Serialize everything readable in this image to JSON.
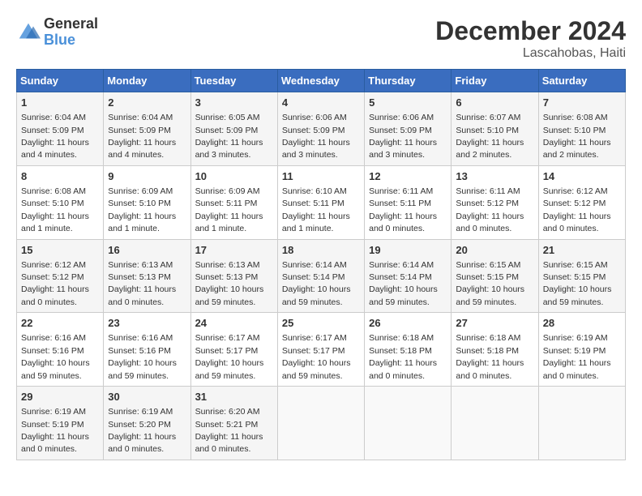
{
  "header": {
    "logo_general": "General",
    "logo_blue": "Blue",
    "title": "December 2024",
    "subtitle": "Lascahobas, Haiti"
  },
  "weekdays": [
    "Sunday",
    "Monday",
    "Tuesday",
    "Wednesday",
    "Thursday",
    "Friday",
    "Saturday"
  ],
  "weeks": [
    [
      {
        "day": "1",
        "sunrise": "6:04 AM",
        "sunset": "5:09 PM",
        "daylight": "11 hours and 4 minutes."
      },
      {
        "day": "2",
        "sunrise": "6:04 AM",
        "sunset": "5:09 PM",
        "daylight": "11 hours and 4 minutes."
      },
      {
        "day": "3",
        "sunrise": "6:05 AM",
        "sunset": "5:09 PM",
        "daylight": "11 hours and 3 minutes."
      },
      {
        "day": "4",
        "sunrise": "6:06 AM",
        "sunset": "5:09 PM",
        "daylight": "11 hours and 3 minutes."
      },
      {
        "day": "5",
        "sunrise": "6:06 AM",
        "sunset": "5:09 PM",
        "daylight": "11 hours and 3 minutes."
      },
      {
        "day": "6",
        "sunrise": "6:07 AM",
        "sunset": "5:10 PM",
        "daylight": "11 hours and 2 minutes."
      },
      {
        "day": "7",
        "sunrise": "6:08 AM",
        "sunset": "5:10 PM",
        "daylight": "11 hours and 2 minutes."
      }
    ],
    [
      {
        "day": "8",
        "sunrise": "6:08 AM",
        "sunset": "5:10 PM",
        "daylight": "11 hours and 1 minute."
      },
      {
        "day": "9",
        "sunrise": "6:09 AM",
        "sunset": "5:10 PM",
        "daylight": "11 hours and 1 minute."
      },
      {
        "day": "10",
        "sunrise": "6:09 AM",
        "sunset": "5:11 PM",
        "daylight": "11 hours and 1 minute."
      },
      {
        "day": "11",
        "sunrise": "6:10 AM",
        "sunset": "5:11 PM",
        "daylight": "11 hours and 1 minute."
      },
      {
        "day": "12",
        "sunrise": "6:11 AM",
        "sunset": "5:11 PM",
        "daylight": "11 hours and 0 minutes."
      },
      {
        "day": "13",
        "sunrise": "6:11 AM",
        "sunset": "5:12 PM",
        "daylight": "11 hours and 0 minutes."
      },
      {
        "day": "14",
        "sunrise": "6:12 AM",
        "sunset": "5:12 PM",
        "daylight": "11 hours and 0 minutes."
      }
    ],
    [
      {
        "day": "15",
        "sunrise": "6:12 AM",
        "sunset": "5:12 PM",
        "daylight": "11 hours and 0 minutes."
      },
      {
        "day": "16",
        "sunrise": "6:13 AM",
        "sunset": "5:13 PM",
        "daylight": "11 hours and 0 minutes."
      },
      {
        "day": "17",
        "sunrise": "6:13 AM",
        "sunset": "5:13 PM",
        "daylight": "10 hours and 59 minutes."
      },
      {
        "day": "18",
        "sunrise": "6:14 AM",
        "sunset": "5:14 PM",
        "daylight": "10 hours and 59 minutes."
      },
      {
        "day": "19",
        "sunrise": "6:14 AM",
        "sunset": "5:14 PM",
        "daylight": "10 hours and 59 minutes."
      },
      {
        "day": "20",
        "sunrise": "6:15 AM",
        "sunset": "5:15 PM",
        "daylight": "10 hours and 59 minutes."
      },
      {
        "day": "21",
        "sunrise": "6:15 AM",
        "sunset": "5:15 PM",
        "daylight": "10 hours and 59 minutes."
      }
    ],
    [
      {
        "day": "22",
        "sunrise": "6:16 AM",
        "sunset": "5:16 PM",
        "daylight": "10 hours and 59 minutes."
      },
      {
        "day": "23",
        "sunrise": "6:16 AM",
        "sunset": "5:16 PM",
        "daylight": "10 hours and 59 minutes."
      },
      {
        "day": "24",
        "sunrise": "6:17 AM",
        "sunset": "5:17 PM",
        "daylight": "10 hours and 59 minutes."
      },
      {
        "day": "25",
        "sunrise": "6:17 AM",
        "sunset": "5:17 PM",
        "daylight": "10 hours and 59 minutes."
      },
      {
        "day": "26",
        "sunrise": "6:18 AM",
        "sunset": "5:18 PM",
        "daylight": "11 hours and 0 minutes."
      },
      {
        "day": "27",
        "sunrise": "6:18 AM",
        "sunset": "5:18 PM",
        "daylight": "11 hours and 0 minutes."
      },
      {
        "day": "28",
        "sunrise": "6:19 AM",
        "sunset": "5:19 PM",
        "daylight": "11 hours and 0 minutes."
      }
    ],
    [
      {
        "day": "29",
        "sunrise": "6:19 AM",
        "sunset": "5:19 PM",
        "daylight": "11 hours and 0 minutes."
      },
      {
        "day": "30",
        "sunrise": "6:19 AM",
        "sunset": "5:20 PM",
        "daylight": "11 hours and 0 minutes."
      },
      {
        "day": "31",
        "sunrise": "6:20 AM",
        "sunset": "5:21 PM",
        "daylight": "11 hours and 0 minutes."
      },
      null,
      null,
      null,
      null
    ]
  ]
}
